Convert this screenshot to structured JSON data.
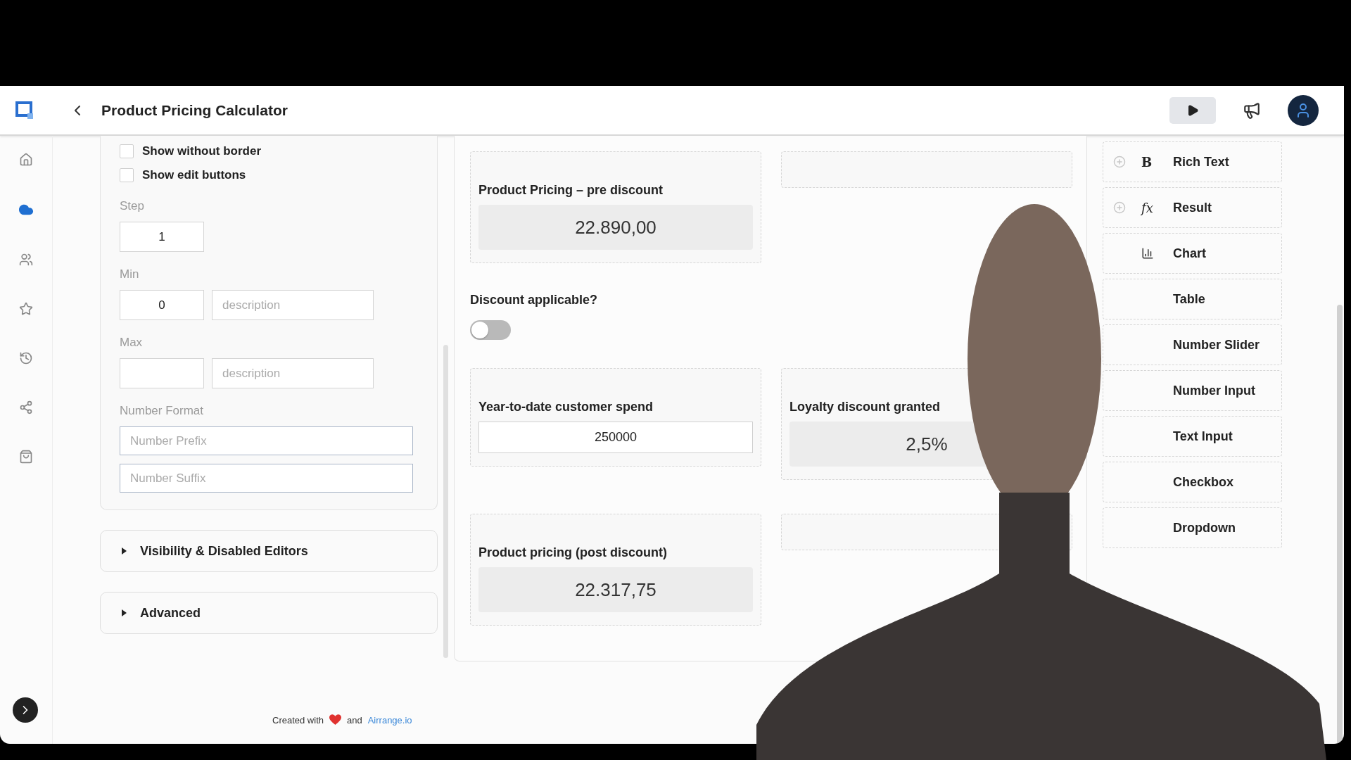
{
  "app_bar": {
    "title": "Product Pricing Calculator"
  },
  "nav_rail": [
    {
      "kind": "home",
      "selected": false
    },
    {
      "kind": "cloud",
      "selected": true
    },
    {
      "kind": "users",
      "selected": false
    },
    {
      "kind": "star",
      "selected": false
    },
    {
      "kind": "history",
      "selected": false
    },
    {
      "kind": "share",
      "selected": false
    },
    {
      "kind": "bag",
      "selected": false
    }
  ],
  "settings_panel": {
    "checkboxes": [
      {
        "label": "Show without border",
        "checked": false
      },
      {
        "label": "Show edit buttons",
        "checked": false
      }
    ],
    "step": {
      "label": "Step",
      "value": "1"
    },
    "min": {
      "label": "Min",
      "value": "0",
      "description_placeholder": "description"
    },
    "max": {
      "label": "Max",
      "description_placeholder": "description"
    },
    "number_format": {
      "label": "Number Format",
      "prefix_placeholder": "Number Prefix",
      "suffix_placeholder": "Number Suffix"
    }
  },
  "sections": [
    {
      "label": "Visibility & Disabled Editors",
      "expanded": false
    },
    {
      "label": "Advanced",
      "expanded": false
    }
  ],
  "footer": {
    "before": "Created with",
    "between": "and",
    "link": "Airrange.io"
  },
  "canvas": {
    "widgets": [
      {
        "kind": "result",
        "label": "Product Pricing – pre discount",
        "value": "22.890,00"
      },
      {
        "kind": "empty"
      },
      {
        "kind": "toggle",
        "label": "Discount applicable?",
        "on": false
      },
      {
        "kind": "number_input",
        "label": "Year-to-date customer spend",
        "value": "250000"
      },
      {
        "kind": "result",
        "label": "Loyalty discount granted",
        "value": "2,5%"
      },
      {
        "kind": "result",
        "label": "Product pricing (post discount)",
        "value": "22.317,75"
      },
      {
        "kind": "empty"
      }
    ]
  },
  "components_panel": {
    "items": [
      {
        "label": "Rich Text",
        "glyph": "B"
      },
      {
        "label": "Result",
        "glyph": "fx"
      },
      {
        "label": "Chart"
      },
      {
        "label": "Table"
      },
      {
        "label": "Number Slider"
      },
      {
        "label": "Number Input"
      },
      {
        "label": "Text Input"
      },
      {
        "label": "Checkbox"
      },
      {
        "label": "Dropdown"
      }
    ]
  }
}
